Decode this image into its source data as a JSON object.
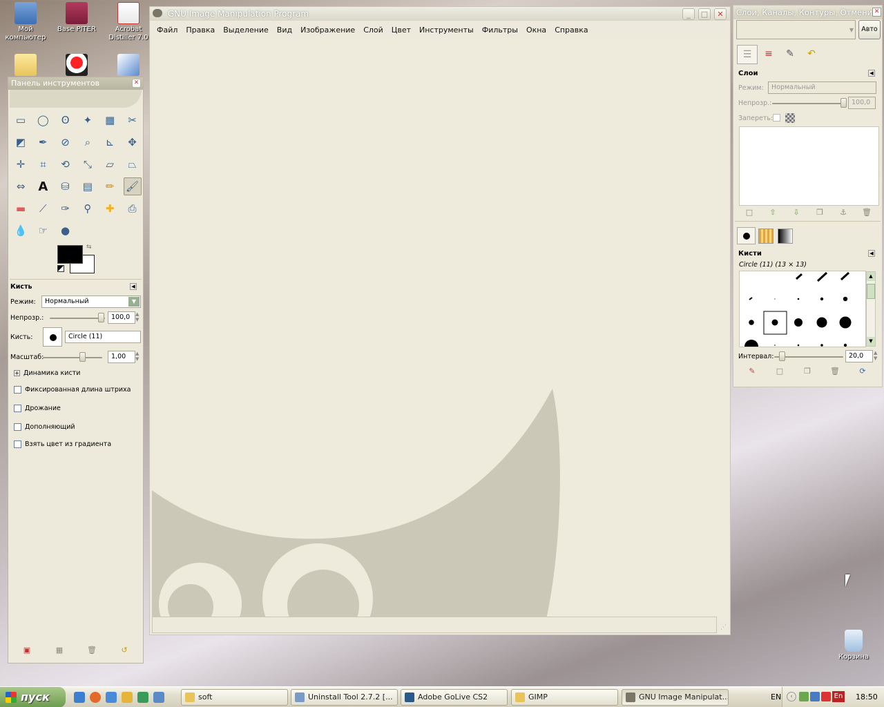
{
  "desktop": {
    "icons": [
      {
        "label": "Мой компьютер",
        "icon": "computer-icon"
      },
      {
        "label": "Base PITER",
        "icon": "app-icon"
      },
      {
        "label": "Acrobat Distiller 7.0",
        "icon": "pdf-icon"
      },
      {
        "label": "Корзина",
        "icon": "recycle-bin-icon"
      }
    ]
  },
  "main_window": {
    "title": "GNU Image Manipulation Program",
    "menu": [
      "Файл",
      "Правка",
      "Выделение",
      "Вид",
      "Изображение",
      "Слой",
      "Цвет",
      "Инструменты",
      "Фильтры",
      "Окна",
      "Справка"
    ]
  },
  "toolbox": {
    "title": "Панель инструментов",
    "tool_name": "Кисть",
    "mode_label": "Режим:",
    "mode_value": "Нормальный",
    "opacity_label": "Непрозр.:",
    "opacity_value": "100,0",
    "opacity_fraction": 1.0,
    "brush_label": "Кисть:",
    "brush_value": "Circle (11)",
    "scale_label": "Масштаб:",
    "scale_value": "1,00",
    "dynamics_label": "Динамика кисти",
    "options": [
      "Фиксированная длина штриха",
      "Дрожание",
      "Дополняющий",
      "Взять цвет из градиента"
    ],
    "fg_color": "#000000",
    "bg_color": "#ffffff"
  },
  "dock": {
    "title": "Слои, Каналы, Контуры, Отмени...",
    "auto_button": "Авто",
    "layers_title": "Слои",
    "mode_label": "Режим:",
    "mode_value": "Нормальный",
    "opacity_label": "Непрозр.:",
    "opacity_value": "100,0",
    "lock_label": "Запереть:",
    "brushes_title": "Кисти",
    "brush_name": "Circle (11) (13 × 13)",
    "spacing_label": "Интервал:",
    "spacing_value": "20,0"
  },
  "taskbar": {
    "start": "пуск",
    "tasks": [
      "soft",
      "Uninstall Tool 2.7.2 [...",
      "Adobe GoLive CS2",
      "GIMP",
      "GNU Image Manipulat..."
    ],
    "lang": "EN",
    "lang_tray": "En",
    "clock": "18:50"
  },
  "colors": {
    "accent": "#3b5f8a",
    "taskbar": "#e2dfce",
    "window": "#ede9dc",
    "wilber": "#cbc8b8"
  }
}
